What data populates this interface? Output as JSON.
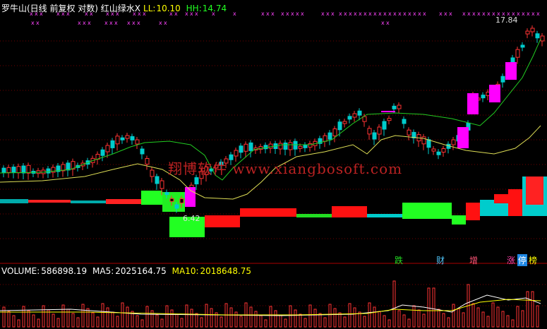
{
  "header": {
    "title": "罗牛山(日线 前复权 对数) 红山绿水X",
    "ll_label": "LL:",
    "ll_value": "10.10",
    "hh_label": "HH:",
    "hh_value": "14.74"
  },
  "price_labels": {
    "high": "17.84",
    "low": "6.42"
  },
  "watermark": "翔博软件 www.xiangbosoft.com",
  "signals": [
    {
      "text": "跌",
      "color": "#22dd22"
    },
    {
      "text": "财",
      "color": "#4fc3f7"
    },
    {
      "text": "增",
      "color": "#ff5577"
    },
    {
      "text": "涨",
      "color": "#ff44aa"
    },
    {
      "text": "停",
      "color": "#ffffff",
      "bg": "#1e88e5"
    },
    {
      "text": "榜",
      "color": "#ffff00"
    }
  ],
  "volume_header": {
    "volume_label": "VOLUME:",
    "volume_value": "586898.19",
    "ma5_label": "MA5:",
    "ma5_value": "2025164.75",
    "ma10_label": "MA10:",
    "ma10_value": "2018648.75"
  },
  "colors": {
    "up": "#ff3333",
    "down": "#00cccc",
    "ma_green": "#22cc22",
    "ma_yellow": "#dddd55",
    "magenta": "#ff00ff",
    "grid": "#8b0000",
    "title": "#ffffff",
    "ll": "#ffff00",
    "hh": "#22ff22",
    "vol_label": "#ffffff",
    "ma5": "#ffffff",
    "ma10": "#ffff00",
    "watermark": "#cc2222"
  }
}
